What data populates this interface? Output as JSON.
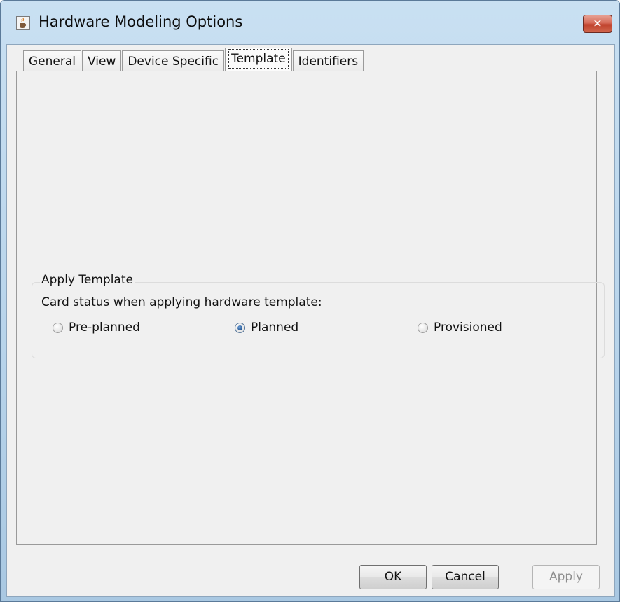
{
  "window": {
    "title": "Hardware Modeling Options",
    "close_glyph": "✕"
  },
  "tabs": [
    {
      "label": "General"
    },
    {
      "label": "View"
    },
    {
      "label": "Device Specific"
    },
    {
      "label": "Template",
      "selected": true
    },
    {
      "label": "Identifiers"
    }
  ],
  "apply_template": {
    "legend": "Apply Template",
    "description": "Card status when applying hardware template:",
    "options": [
      {
        "label": "Pre-planned",
        "checked": false
      },
      {
        "label": "Planned",
        "checked": true
      },
      {
        "label": "Provisioned",
        "checked": false
      }
    ]
  },
  "buttons": {
    "ok": "OK",
    "cancel": "Cancel",
    "apply": "Apply",
    "apply_enabled": false
  },
  "icons": {
    "app": "java-cup-icon",
    "close": "close-icon"
  },
  "colors": {
    "window_frame": "#b7d3ea",
    "client_bg": "#f0f0f0",
    "close_button": "#c0432d"
  }
}
